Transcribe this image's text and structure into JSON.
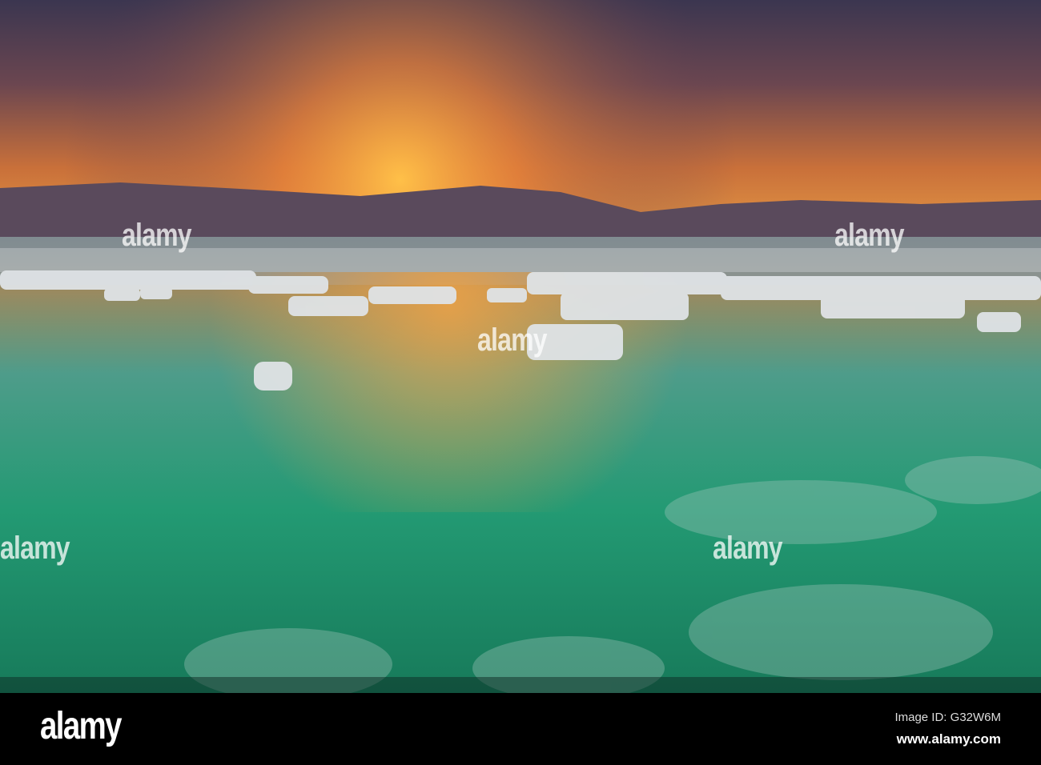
{
  "footer": {
    "logo": "alamy",
    "image_id": "Image ID: G32W6M",
    "website": "www.alamy.com"
  },
  "watermark": "alamy",
  "colors": {
    "sky_top": "#3a3550",
    "sun": "#f7a531",
    "water": "#1f8a6a"
  }
}
